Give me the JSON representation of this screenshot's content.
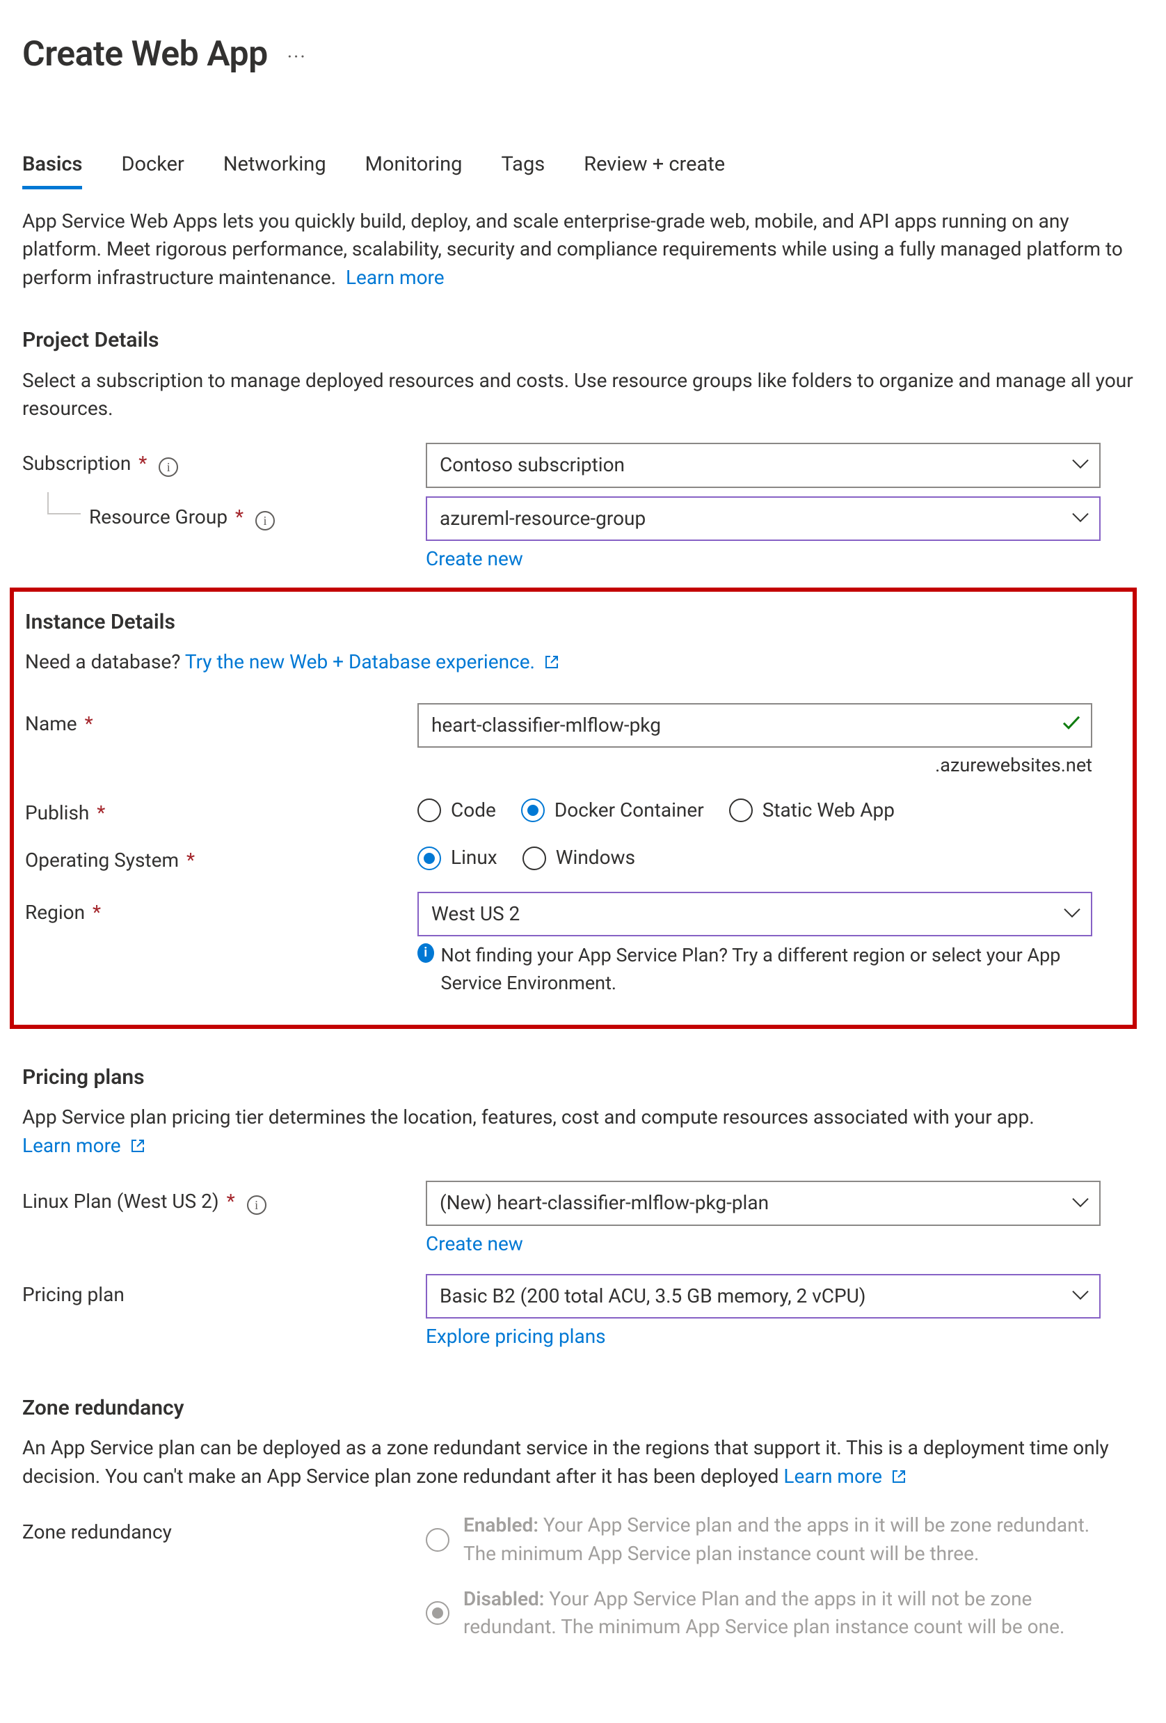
{
  "header": {
    "title": "Create Web App"
  },
  "tabs": [
    "Basics",
    "Docker",
    "Networking",
    "Monitoring",
    "Tags",
    "Review + create"
  ],
  "active_tab_index": 0,
  "intro": {
    "text": "App Service Web Apps lets you quickly build, deploy, and scale enterprise-grade web, mobile, and API apps running on any platform. Meet rigorous performance, scalability, security and compliance requirements while using a fully managed platform to perform infrastructure maintenance.",
    "learn_more": "Learn more"
  },
  "project_details": {
    "heading": "Project Details",
    "desc": "Select a subscription to manage deployed resources and costs. Use resource groups like folders to organize and manage all your resources.",
    "subscription": {
      "label": "Subscription",
      "value": "Contoso subscription"
    },
    "rg": {
      "label": "Resource Group",
      "value": "azureml-resource-group",
      "create_new": "Create new"
    }
  },
  "instance": {
    "heading": "Instance Details",
    "db_prompt": "Need a database?",
    "db_link": "Try the new Web + Database experience.",
    "name": {
      "label": "Name",
      "value": "heart-classifier-mlflow-pkg",
      "suffix": ".azurewebsites.net"
    },
    "publish": {
      "label": "Publish",
      "options": [
        "Code",
        "Docker Container",
        "Static Web App"
      ],
      "selected_index": 1
    },
    "os": {
      "label": "Operating System",
      "options": [
        "Linux",
        "Windows"
      ],
      "selected_index": 0
    },
    "region": {
      "label": "Region",
      "value": "West US 2",
      "hint": "Not finding your App Service Plan? Try a different region or select your App Service Environment."
    }
  },
  "pricing": {
    "heading": "Pricing plans",
    "desc": "App Service plan pricing tier determines the location, features, cost and compute resources associated with your app.",
    "learn_more": "Learn more",
    "plan": {
      "label": "Linux Plan (West US 2)",
      "value": "(New) heart-classifier-mlflow-pkg-plan",
      "create_new": "Create new"
    },
    "pricing_plan": {
      "label": "Pricing plan",
      "value": "Basic B2 (200 total ACU, 3.5 GB memory, 2 vCPU)",
      "explore": "Explore pricing plans"
    }
  },
  "zone": {
    "heading": "Zone redundancy",
    "desc": "An App Service plan can be deployed as a zone redundant service in the regions that support it. This is a deployment time only decision. You can't make an App Service plan zone redundant after it has been deployed",
    "learn_more": "Learn more",
    "label": "Zone redundancy",
    "options": [
      {
        "title": "Enabled:",
        "desc": "Your App Service plan and the apps in it will be zone redundant. The minimum App Service plan instance count will be three."
      },
      {
        "title": "Disabled:",
        "desc": "Your App Service Plan and the apps in it will not be zone redundant. The minimum App Service plan instance count will be one."
      }
    ],
    "selected_index": 1
  }
}
